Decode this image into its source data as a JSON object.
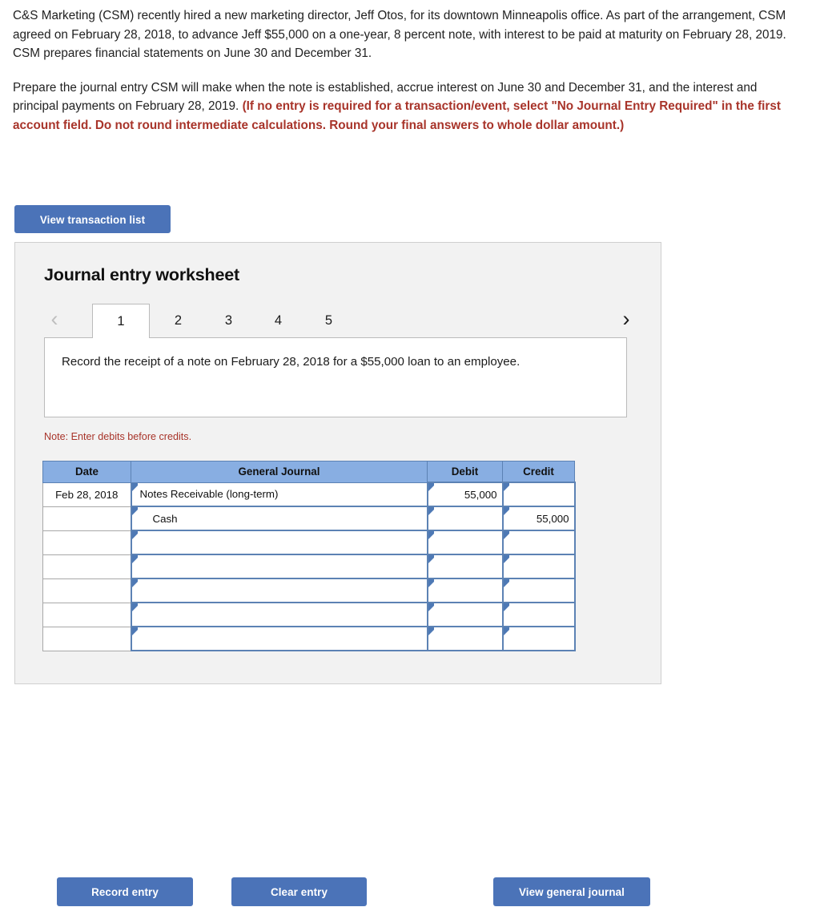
{
  "problem": {
    "paragraph1": "C&S Marketing (CSM) recently hired a new marketing director, Jeff Otos, for its downtown Minneapolis office. As part of the arrangement, CSM agreed on February 28, 2018, to advance Jeff $55,000 on a one-year, 8 percent note, with interest to be paid at maturity on February 28, 2019. CSM prepares financial statements on June 30 and December 31.",
    "paragraph2_normal": "Prepare the journal entry CSM will make when the note is established, accrue interest on June 30 and December 31, and the interest and principal payments on February 28, 2019. ",
    "paragraph2_emphasis": "(If no entry is required for a transaction/event, select \"No Journal Entry Required\" in the first account field. Do not round intermediate calculations. Round your final answers to whole dollar amount.)"
  },
  "buttons": {
    "view_transaction_list": "View transaction list",
    "record_entry": "Record entry",
    "clear_entry": "Clear entry",
    "view_general_journal": "View general journal"
  },
  "worksheet": {
    "title": "Journal entry worksheet",
    "prev_arrow": "‹",
    "next_arrow": "›",
    "tabs": [
      {
        "label": "1",
        "active": true
      },
      {
        "label": "2",
        "active": false
      },
      {
        "label": "3",
        "active": false
      },
      {
        "label": "4",
        "active": false
      },
      {
        "label": "5",
        "active": false
      }
    ],
    "instruction": "Record the receipt of a note on February 28, 2018 for a $55,000 loan to an employee.",
    "note": "Note: Enter debits before credits."
  },
  "journal": {
    "columns": [
      "Date",
      "General Journal",
      "Debit",
      "Credit"
    ],
    "rows": [
      {
        "date": "Feb 28, 2018",
        "account": "Notes Receivable (long-term)",
        "indent": false,
        "debit": "55,000",
        "credit": "",
        "filled": true
      },
      {
        "date": "",
        "account": "Cash",
        "indent": true,
        "debit": "",
        "credit": "55,000",
        "filled": true
      },
      {
        "date": "",
        "account": "",
        "indent": false,
        "debit": "",
        "credit": "",
        "filled": false
      },
      {
        "date": "",
        "account": "",
        "indent": false,
        "debit": "",
        "credit": "",
        "filled": false
      },
      {
        "date": "",
        "account": "",
        "indent": false,
        "debit": "",
        "credit": "",
        "filled": false
      },
      {
        "date": "",
        "account": "",
        "indent": false,
        "debit": "",
        "credit": "",
        "filled": false
      },
      {
        "date": "",
        "account": "",
        "indent": false,
        "debit": "",
        "credit": "",
        "filled": false
      }
    ]
  },
  "colors": {
    "button_blue": "#4B73B8",
    "table_header_blue": "#88AEE2",
    "cell_border_blue": "#5C82B4",
    "emphasis_red": "#A8342A",
    "panel_gray": "#F2F2F2"
  }
}
